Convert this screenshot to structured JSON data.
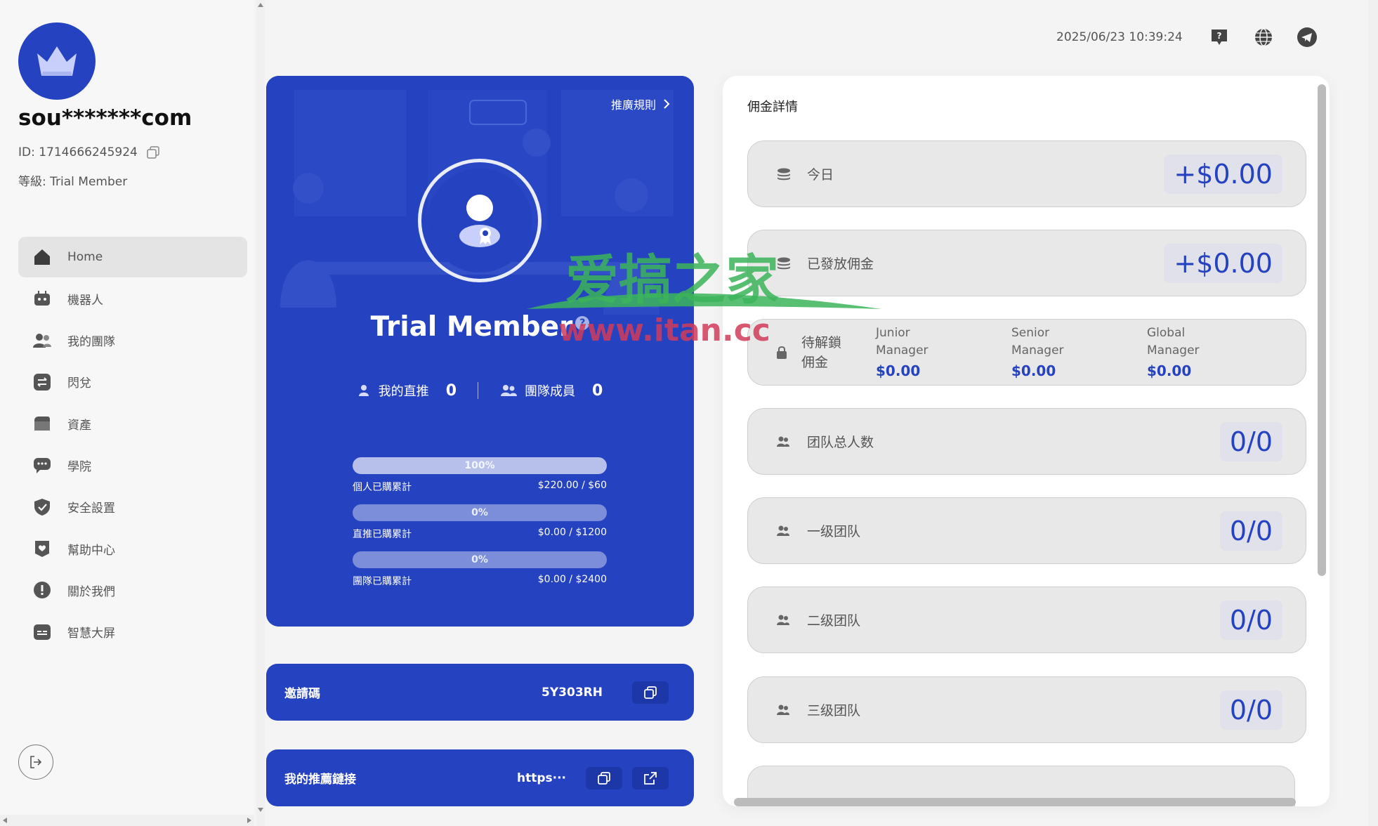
{
  "user": {
    "name": "sou*******com",
    "id_label": "ID: 1714666245924",
    "level_label": "等級: Trial Member"
  },
  "nav": {
    "items": [
      {
        "label": "Home",
        "icon": "home-icon",
        "active": true
      },
      {
        "label": "機器人",
        "icon": "robot-icon"
      },
      {
        "label": "我的團隊",
        "icon": "team-icon"
      },
      {
        "label": "閃兌",
        "icon": "swap-icon"
      },
      {
        "label": "資產",
        "icon": "wallet-icon"
      },
      {
        "label": "學院",
        "icon": "chat-icon"
      },
      {
        "label": "安全設置",
        "icon": "shield-icon"
      },
      {
        "label": "幫助中心",
        "icon": "heart-icon"
      },
      {
        "label": "關於我們",
        "icon": "info-icon"
      },
      {
        "label": "智慧大屏",
        "icon": "screen-icon"
      }
    ]
  },
  "header": {
    "datetime": "2025/06/23 10:39:24"
  },
  "member_card": {
    "promo_rule": "推廣規則",
    "title": "Trial Member",
    "help_badge": "?",
    "direct_label": "我的直推",
    "direct_count": "0",
    "team_label": "團隊成員",
    "team_count": "0",
    "progress": [
      {
        "percent_text": "100%",
        "fill": 1.0,
        "label": "個人已購累計",
        "value": "$220.00 / $60"
      },
      {
        "percent_text": "0%",
        "fill": 0.0,
        "label": "直推已購累計",
        "value": "$0.00 / $1200"
      },
      {
        "percent_text": "0%",
        "fill": 0.0,
        "label": "團隊已購累計",
        "value": "$0.00 / $2400"
      }
    ]
  },
  "invite": {
    "label": "邀請碼",
    "code": "5Y303RH"
  },
  "referral": {
    "label": "我的推薦鏈接",
    "link": "https···"
  },
  "commission": {
    "title": "佣金詳情",
    "today_label": "今日",
    "today_value": "+$0.00",
    "issued_label": "已發放佣金",
    "issued_value": "+$0.00",
    "pending_label": "待解鎖佣金",
    "pending": [
      {
        "line1": "Junior",
        "line2": "Manager",
        "amount": "$0.00"
      },
      {
        "line1": "Senior",
        "line2": "Manager",
        "amount": "$0.00"
      },
      {
        "line1": "Global",
        "line2": "Manager",
        "amount": "$0.00"
      }
    ],
    "team_total_label": "团队总人数",
    "team_total_value": "0/0",
    "level1_label": "一级团队",
    "level1_value": "0/0",
    "level2_label": "二级团队",
    "level2_value": "0/0",
    "level3_label": "三级团队",
    "level3_value": "0/0"
  },
  "watermark": {
    "line1": "爱搞之家",
    "line2": "www.itan.cc"
  },
  "colors": {
    "brand": "#2542c0",
    "brand_dark": "#1e37a8",
    "value_text": "#2542c0"
  }
}
